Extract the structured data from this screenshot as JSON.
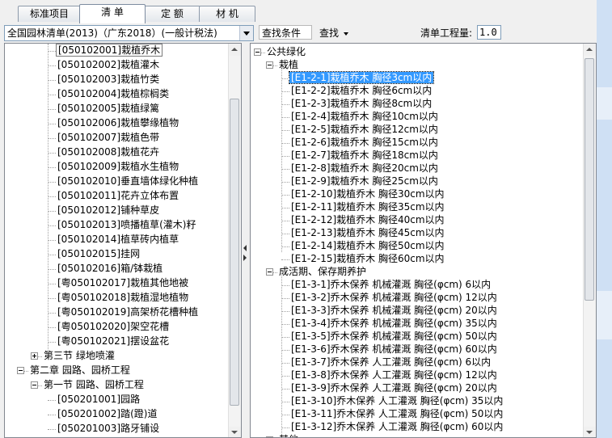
{
  "tabs": [
    {
      "label": "标准项目"
    },
    {
      "label": "清 单"
    },
    {
      "label": "定 额"
    },
    {
      "label": "材 机"
    }
  ],
  "toolbar": {
    "library_value": "全国园林清单(2013)（广东2018）(一般计税法)",
    "find_condition": "查找条件",
    "find_button": "查找",
    "qty_label": "清单工程量:",
    "qty_value": "1.0"
  },
  "left_tree": {
    "items": [
      {
        "label": "[050102001]栽植乔木",
        "level": 3,
        "state": "boxed"
      },
      {
        "label": "[050102002]栽植灌木",
        "level": 3
      },
      {
        "label": "[050102003]栽植竹类",
        "level": 3
      },
      {
        "label": "[050102004]栽植棕榈类",
        "level": 3
      },
      {
        "label": "[050102005]栽植绿篱",
        "level": 3
      },
      {
        "label": "[050102006]栽植攀缘植物",
        "level": 3
      },
      {
        "label": "[050102007]栽植色带",
        "level": 3
      },
      {
        "label": "[050102008]栽植花卉",
        "level": 3
      },
      {
        "label": "[050102009]栽植水生植物",
        "level": 3
      },
      {
        "label": "[050102010]垂直墙体绿化种植",
        "level": 3
      },
      {
        "label": "[050102011]花卉立体布置",
        "level": 3
      },
      {
        "label": "[050102012]铺种草皮",
        "level": 3
      },
      {
        "label": "[050102013]喷播植草(灌木)籽",
        "level": 3
      },
      {
        "label": "[050102014]植草砖内植草",
        "level": 3
      },
      {
        "label": "[050102015]挂网",
        "level": 3
      },
      {
        "label": "[050102016]箱/钵栽植",
        "level": 3
      },
      {
        "label": "[粤050102017]栽植其他地被",
        "level": 3
      },
      {
        "label": "[粤050102018]栽植湿地植物",
        "level": 3
      },
      {
        "label": "[粤050102019]高架桥花槽种植",
        "level": 3
      },
      {
        "label": "[粤050102020]架空花槽",
        "level": 3
      },
      {
        "label": "[粤050102021]摆设盆花",
        "level": 3
      },
      {
        "label": "第三节 绿地喷灌",
        "level": 2,
        "expander": "plus"
      },
      {
        "label": "第二章 园路、园桥工程",
        "level": 1,
        "expander": "minus"
      },
      {
        "label": "第一节 园路、园桥工程",
        "level": 2,
        "expander": "minus"
      },
      {
        "label": "[050201001]园路",
        "level": 3
      },
      {
        "label": "[050201002]踏(蹬)道",
        "level": 3
      },
      {
        "label": "[050201003]路牙铺设",
        "level": 3
      }
    ]
  },
  "right_tree": {
    "items": [
      {
        "label": "公共绿化",
        "level": 0,
        "expander": "minus"
      },
      {
        "label": "栽植",
        "level": 1,
        "expander": "minus"
      },
      {
        "label": "[E1-2-1]栽植乔木 胸径3cm以内",
        "level": 2,
        "state": "selected"
      },
      {
        "label": "[E1-2-2]栽植乔木 胸径6cm以内",
        "level": 2
      },
      {
        "label": "[E1-2-3]栽植乔木 胸径8cm以内",
        "level": 2
      },
      {
        "label": "[E1-2-4]栽植乔木 胸径10cm以内",
        "level": 2
      },
      {
        "label": "[E1-2-5]栽植乔木 胸径12cm以内",
        "level": 2
      },
      {
        "label": "[E1-2-6]栽植乔木 胸径15cm以内",
        "level": 2
      },
      {
        "label": "[E1-2-7]栽植乔木 胸径18cm以内",
        "level": 2
      },
      {
        "label": "[E1-2-8]栽植乔木 胸径20cm以内",
        "level": 2
      },
      {
        "label": "[E1-2-9]栽植乔木 胸径25cm以内",
        "level": 2
      },
      {
        "label": "[E1-2-10]栽植乔木 胸径30cm以内",
        "level": 2
      },
      {
        "label": "[E1-2-11]栽植乔木 胸径35cm以内",
        "level": 2
      },
      {
        "label": "[E1-2-12]栽植乔木 胸径40cm以内",
        "level": 2
      },
      {
        "label": "[E1-2-13]栽植乔木 胸径45cm以内",
        "level": 2
      },
      {
        "label": "[E1-2-14]栽植乔木 胸径50cm以内",
        "level": 2
      },
      {
        "label": "[E1-2-15]栽植乔木 胸径60cm以内",
        "level": 2
      },
      {
        "label": "成活期、保存期养护",
        "level": 1,
        "expander": "minus"
      },
      {
        "label": "[E1-3-1]乔木保养 机械灌溉 胸径(φcm) 6以内",
        "level": 2
      },
      {
        "label": "[E1-3-2]乔木保养 机械灌溉 胸径(φcm) 12以内",
        "level": 2
      },
      {
        "label": "[E1-3-3]乔木保养 机械灌溉 胸径(φcm) 20以内",
        "level": 2
      },
      {
        "label": "[E1-3-4]乔木保养 机械灌溉 胸径(φcm) 35以内",
        "level": 2
      },
      {
        "label": "[E1-3-5]乔木保养 机械灌溉 胸径(φcm) 50以内",
        "level": 2
      },
      {
        "label": "[E1-3-6]乔木保养 机械灌溉 胸径(φcm) 60以内",
        "level": 2
      },
      {
        "label": "[E1-3-7]乔木保养 人工灌溉 胸径(φcm) 6以内",
        "level": 2
      },
      {
        "label": "[E1-3-8]乔木保养 人工灌溉 胸径(φcm) 12以内",
        "level": 2
      },
      {
        "label": "[E1-3-9]乔木保养 人工灌溉 胸径(φcm) 20以内",
        "level": 2
      },
      {
        "label": "[E1-3-10]乔木保养 人工灌溉 胸径(φcm) 35以内",
        "level": 2
      },
      {
        "label": "[E1-3-11]乔木保养 人工灌溉 胸径(φcm) 50以内",
        "level": 2
      },
      {
        "label": "[E1-3-12]乔木保养 人工灌溉 胸径(φcm) 60以内",
        "level": 2
      },
      {
        "label": "其他",
        "level": 1,
        "expander": "plus"
      }
    ]
  },
  "colors": {
    "selection": "#3399ff",
    "window_bg": "#f0f0f0",
    "border": "#828790"
  },
  "icons": {
    "combo_dropdown": "chevron-down-icon",
    "find_dropdown": "caret-down-icon",
    "splitter": "collapse-arrows-icon"
  }
}
